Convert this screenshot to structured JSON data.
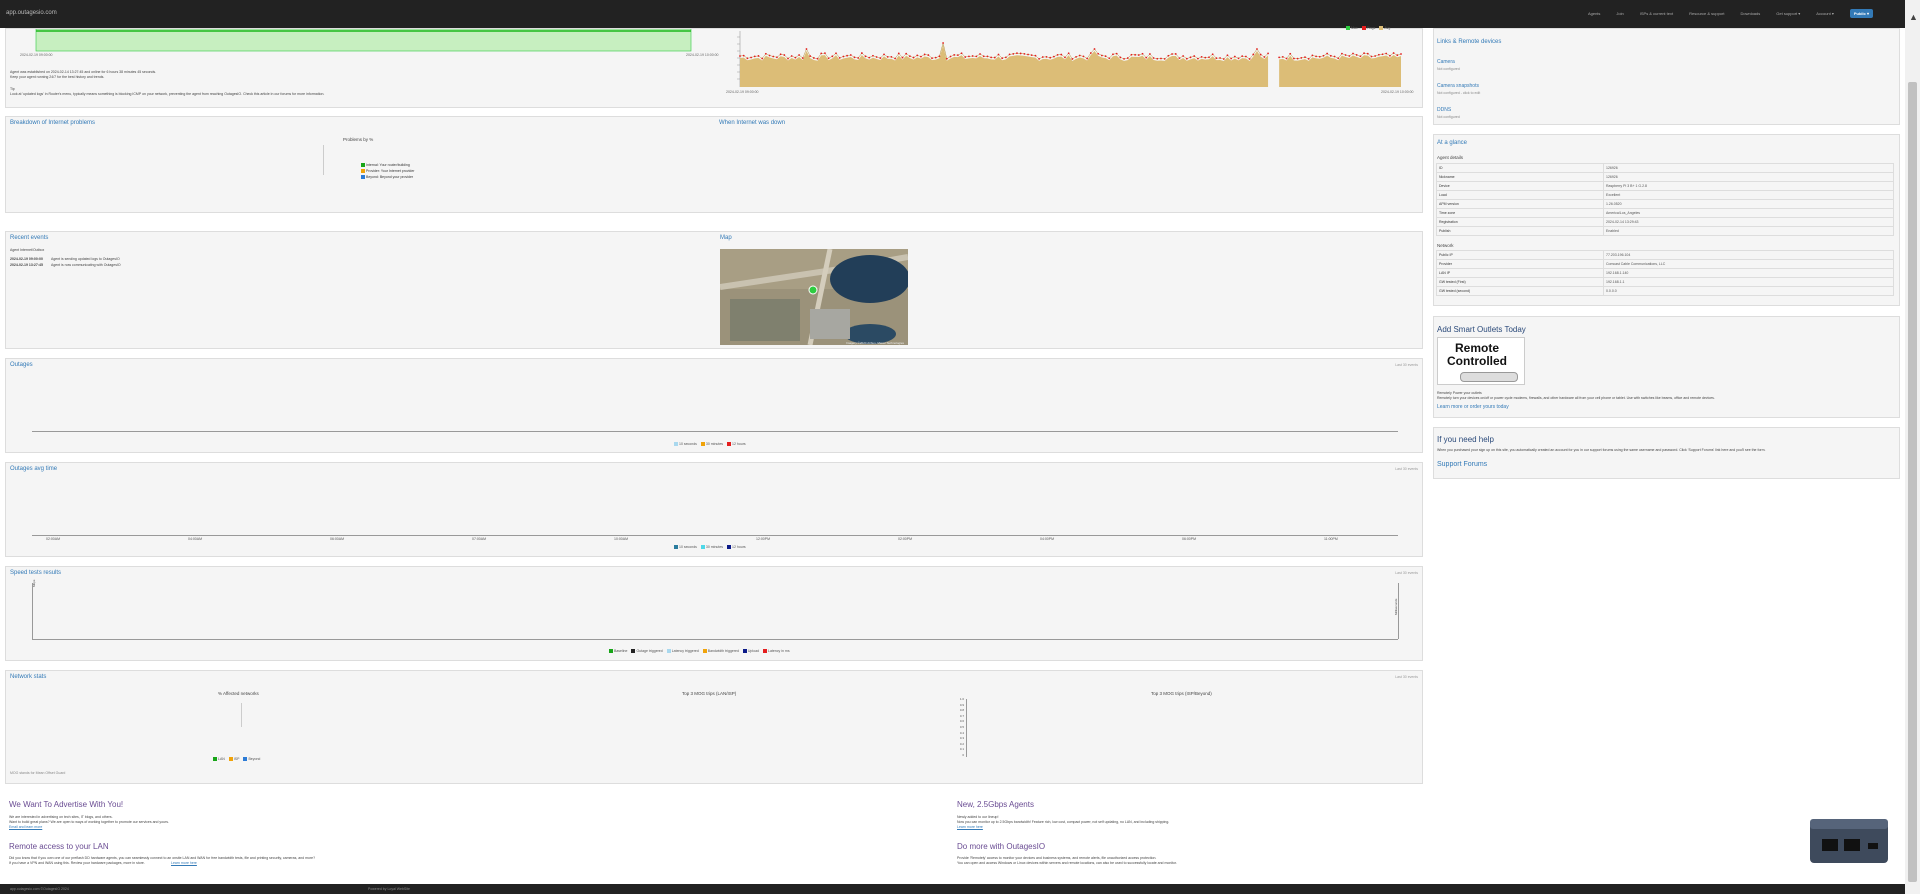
{
  "app": {
    "brand": "app.outagesio.com",
    "nav": [
      "Agents",
      "Join",
      "ISPs & current text",
      "Resource & support",
      "Downloads",
      "Get support ▾",
      "Account ▾"
    ],
    "cta": "Public ▾",
    "colors": {
      "accent": "#337ab7",
      "panel": "#f5f5f5",
      "green_fill": "#c7efc0",
      "tan_fill": "#dcbd77",
      "red_dots": "#e41e1e"
    }
  },
  "top_left": {
    "start": "2024-02-19 09:00:00",
    "end": "2024-02-19 10:00:00",
    "line1": "Agent was established on 2024-02-14 13:27:45 and online for 6 hours 38 minutes 45 seconds.",
    "line2": "Keep your agent running 24/7 for the best history and trends.",
    "line3": "Tip",
    "line4": "Look at 'updated logs' in Router's menu, typically means something is blocking ICMP on your network, preventing the agent from reaching OutagesIO. Check this article in our forums for more information."
  },
  "top_right": {
    "start": "2024-02-19 09:00:00",
    "end": "2024-02-19 10:00:00",
    "legend": [
      "Max",
      "Pings",
      "Avg"
    ]
  },
  "breakdown": {
    "title": "Breakdown of Internet problems",
    "chart_title": "Problems by %",
    "legend": [
      "Internal: Your router/building",
      "Provider: Your Internet provider",
      "Beyond: Beyond your provider"
    ]
  },
  "when_down": {
    "title": "When Internet was down"
  },
  "events": {
    "title": "Recent events",
    "heading": "Agent Internet/Outbox",
    "rows": [
      {
        "time": "2024-02-19 09:00:00",
        "text": "Agent is sending updated logs to OutagesIO"
      },
      {
        "time": "2024-02-19 13:27:45",
        "text": "Agent is now communicating with OutagesIO"
      }
    ]
  },
  "map": {
    "title": "Map",
    "credit": "Imagery ©2024 Airbus, Maxar Technologies"
  },
  "outages": {
    "title": "Outages",
    "range": "Last 30 events",
    "legend": [
      "10 seconds",
      "30 minutes",
      "12 hours"
    ]
  },
  "outages_avg": {
    "title": "Outages avg time",
    "range": "Last 30 events",
    "ticks": [
      "02:00AM",
      "04:00AM",
      "06:00AM",
      "07:00AM",
      "10:00AM",
      "12:00PM",
      "02:00PM",
      "04:00PM",
      "06:00PM",
      "11:00PM"
    ],
    "legend": [
      "10 seconds",
      "30 minutes",
      "12 hours"
    ]
  },
  "speed": {
    "title": "Speed tests results",
    "range": "Last 30 events",
    "y_left": "Mbps",
    "y_right": "Milliseconds",
    "legend": [
      "Baseline",
      "Outage triggered",
      "Latency triggered",
      "Bandwidth triggered",
      "Upload",
      "Latency in ms"
    ]
  },
  "netstats": {
    "title": "Network stats",
    "range": "Last 30 events",
    "c1": "% Affected networks",
    "c2": "Top 3 MOG trips (LAN/ISP)",
    "c3": "Top 3 MOG trips (ISP/Beyond)",
    "legend": [
      "LAN",
      "ISP",
      "Beyond"
    ],
    "yticks": [
      "1.0",
      "0.9",
      "0.8",
      "0.7",
      "0.6",
      "0.5",
      "0.4",
      "0.3",
      "0.2",
      "0.1",
      "0"
    ],
    "footer": "MOG stands for Mean Offset Guard"
  },
  "sidebar": {
    "links_title": "Links & Remote devices",
    "links": [
      {
        "name": "Camera",
        "desc": "Not configured"
      },
      {
        "name": "Camera snapshots",
        "desc": "Not configured - click to edit"
      },
      {
        "name": "DDNS",
        "desc": "Not configured"
      }
    ],
    "glance_title": "At a glance",
    "agent_details_label": "Agent details",
    "agent_details": [
      [
        "ID",
        "126926"
      ],
      [
        "Nickname",
        "126926"
      ],
      [
        "Device",
        "Raspberry Pi 3 B+ 1 G.2.8"
      ],
      [
        "Load",
        "Excellent"
      ],
      [
        "APM version",
        "1.26.0520"
      ],
      [
        "Time zone",
        "America/Los_Angeles"
      ],
      [
        "Registration",
        "2024-02-14 13:29:43"
      ],
      [
        "Publish",
        "Enabled"
      ]
    ],
    "network_label": "Network",
    "network": [
      [
        "Public IP",
        "77.203.196.104"
      ],
      [
        "Provider",
        "Comcast Cable Communications, LLC"
      ],
      [
        "LAN IP",
        "192.168.1.140"
      ],
      [
        "GW tested (First)",
        "192.168.1.1"
      ],
      [
        "GW tested (second)",
        "0.0.0.0"
      ]
    ],
    "smart_title": "Add Smart Outlets Today",
    "smart_logo": "Remote Controlled",
    "smart_text1": "Remotely Power your outlets",
    "smart_text2": "Remotely turn your devices on/off or power cycle modems, firewalls, and other hardware all from your cell phone or tablet. Use with switches like beams, office and remote devices.",
    "smart_link": "Learn more or order yours today",
    "help_title": "If you need help",
    "help_text": "When you purchased your sign up on this site, you automatically created an account for you in our support forums using the same username and password. Click 'Support Forums' link here and you'll see the form.",
    "help_link": "Support Forums"
  },
  "ads": [
    {
      "title": "We Want To Advertise With You!",
      "l1": "We are interested in advertising on tech sites, IT blogs, and others.",
      "l2": "Want to build great plans? We are open to ways of working together to promote our services and yours.",
      "link": "Email and learn more"
    },
    {
      "title": "Remote access to your LAN",
      "l1": "Did you know that if you own one of our preflash DD hardware agents, you can seamlessly connect to an onsite LAN and WAN for free bandwidth tests, file and printing security, cameras, and more?",
      "l2": "If you have a VPN and WAN using this. Review your hardware packages, more in store.",
      "link": "Learn more here"
    },
    {
      "title": "New, 2.5Gbps Agents",
      "l1": "Newly added to our lineup!",
      "l2": "Now you can monitor up to 2.5Gbps bandwidth! Feature rich, low cost, compact power, not self updating, no LAN, and including shipping.",
      "link": "Learn more here"
    },
    {
      "title": "Do more with OutagesIO",
      "l1": "Provide 'Remotely' access to monitor your devices and business systems, and remote alerts, file unauthorized access protection.",
      "l2": "You can open and access Windows or Linux devices within servers and remote locations, can also be used to successfully locate and monitor."
    }
  ],
  "footer": {
    "left": "app.outagesio.com ©OutagesIO 2024",
    "mid": "Powered by Loyal WebSite"
  }
}
